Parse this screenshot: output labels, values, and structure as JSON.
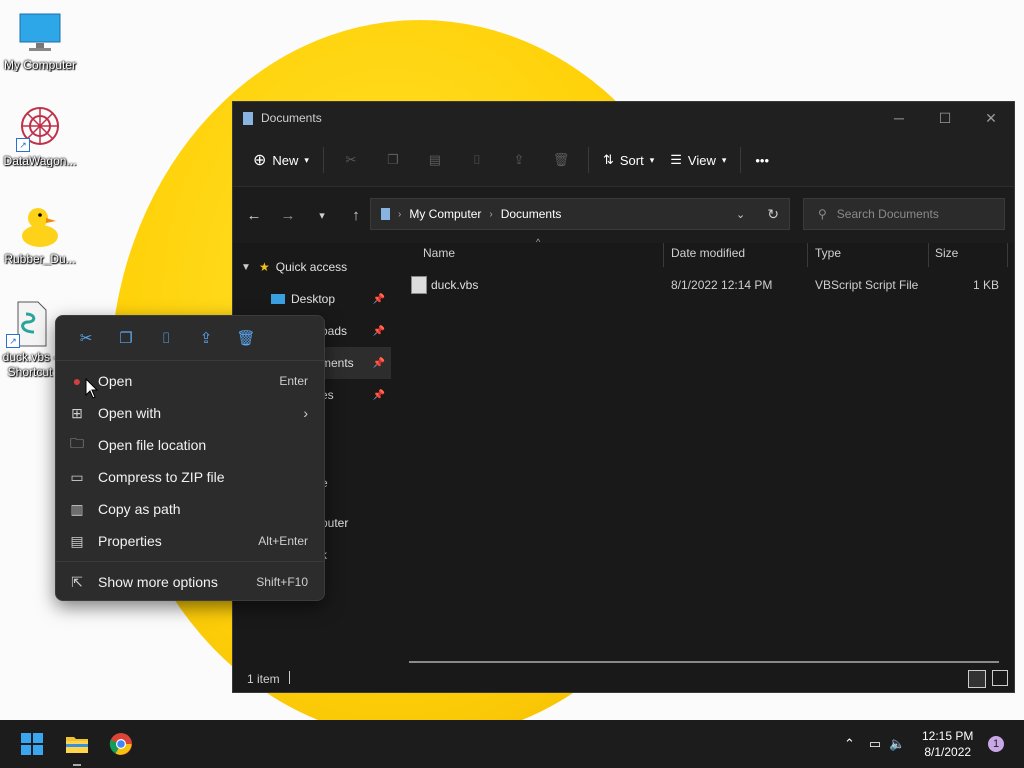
{
  "desktop": {
    "icons": [
      {
        "label": "My Computer"
      },
      {
        "label": "DataWagon..."
      },
      {
        "label": "Rubber_Du..."
      },
      {
        "label": "duck.vbs - Shortcut"
      }
    ]
  },
  "explorer": {
    "title": "Documents",
    "toolbar": {
      "new_label": "New",
      "sort_label": "Sort",
      "view_label": "View",
      "more_label": "•••"
    },
    "address": {
      "root": "My Computer",
      "current": "Documents"
    },
    "search": {
      "placeholder": "Search Documents"
    },
    "nav": {
      "quick_access": "Quick access",
      "items": [
        "Desktop",
        "Downloads",
        "Documents",
        "Pictures"
      ],
      "partial_labels": [
        "oads",
        "ments",
        "es",
        "e",
        "puter",
        "k"
      ]
    },
    "columns": {
      "name": "Name",
      "date": "Date modified",
      "type": "Type",
      "size": "Size"
    },
    "files": [
      {
        "name": "duck.vbs",
        "date": "8/1/2022 12:14 PM",
        "type": "VBScript Script File",
        "size": "1 KB"
      }
    ],
    "status": {
      "count": "1 item"
    }
  },
  "context_menu": {
    "items": [
      {
        "label": "Open",
        "shortcut": "Enter"
      },
      {
        "label": "Open with",
        "shortcut": ""
      },
      {
        "label": "Open file location",
        "shortcut": ""
      },
      {
        "label": "Compress to ZIP file",
        "shortcut": ""
      },
      {
        "label": "Copy as path",
        "shortcut": ""
      },
      {
        "label": "Properties",
        "shortcut": "Alt+Enter"
      },
      {
        "label": "Show more options",
        "shortcut": "Shift+F10"
      }
    ]
  },
  "taskbar": {
    "time": "12:15 PM",
    "date": "8/1/2022",
    "notification_count": "1"
  }
}
